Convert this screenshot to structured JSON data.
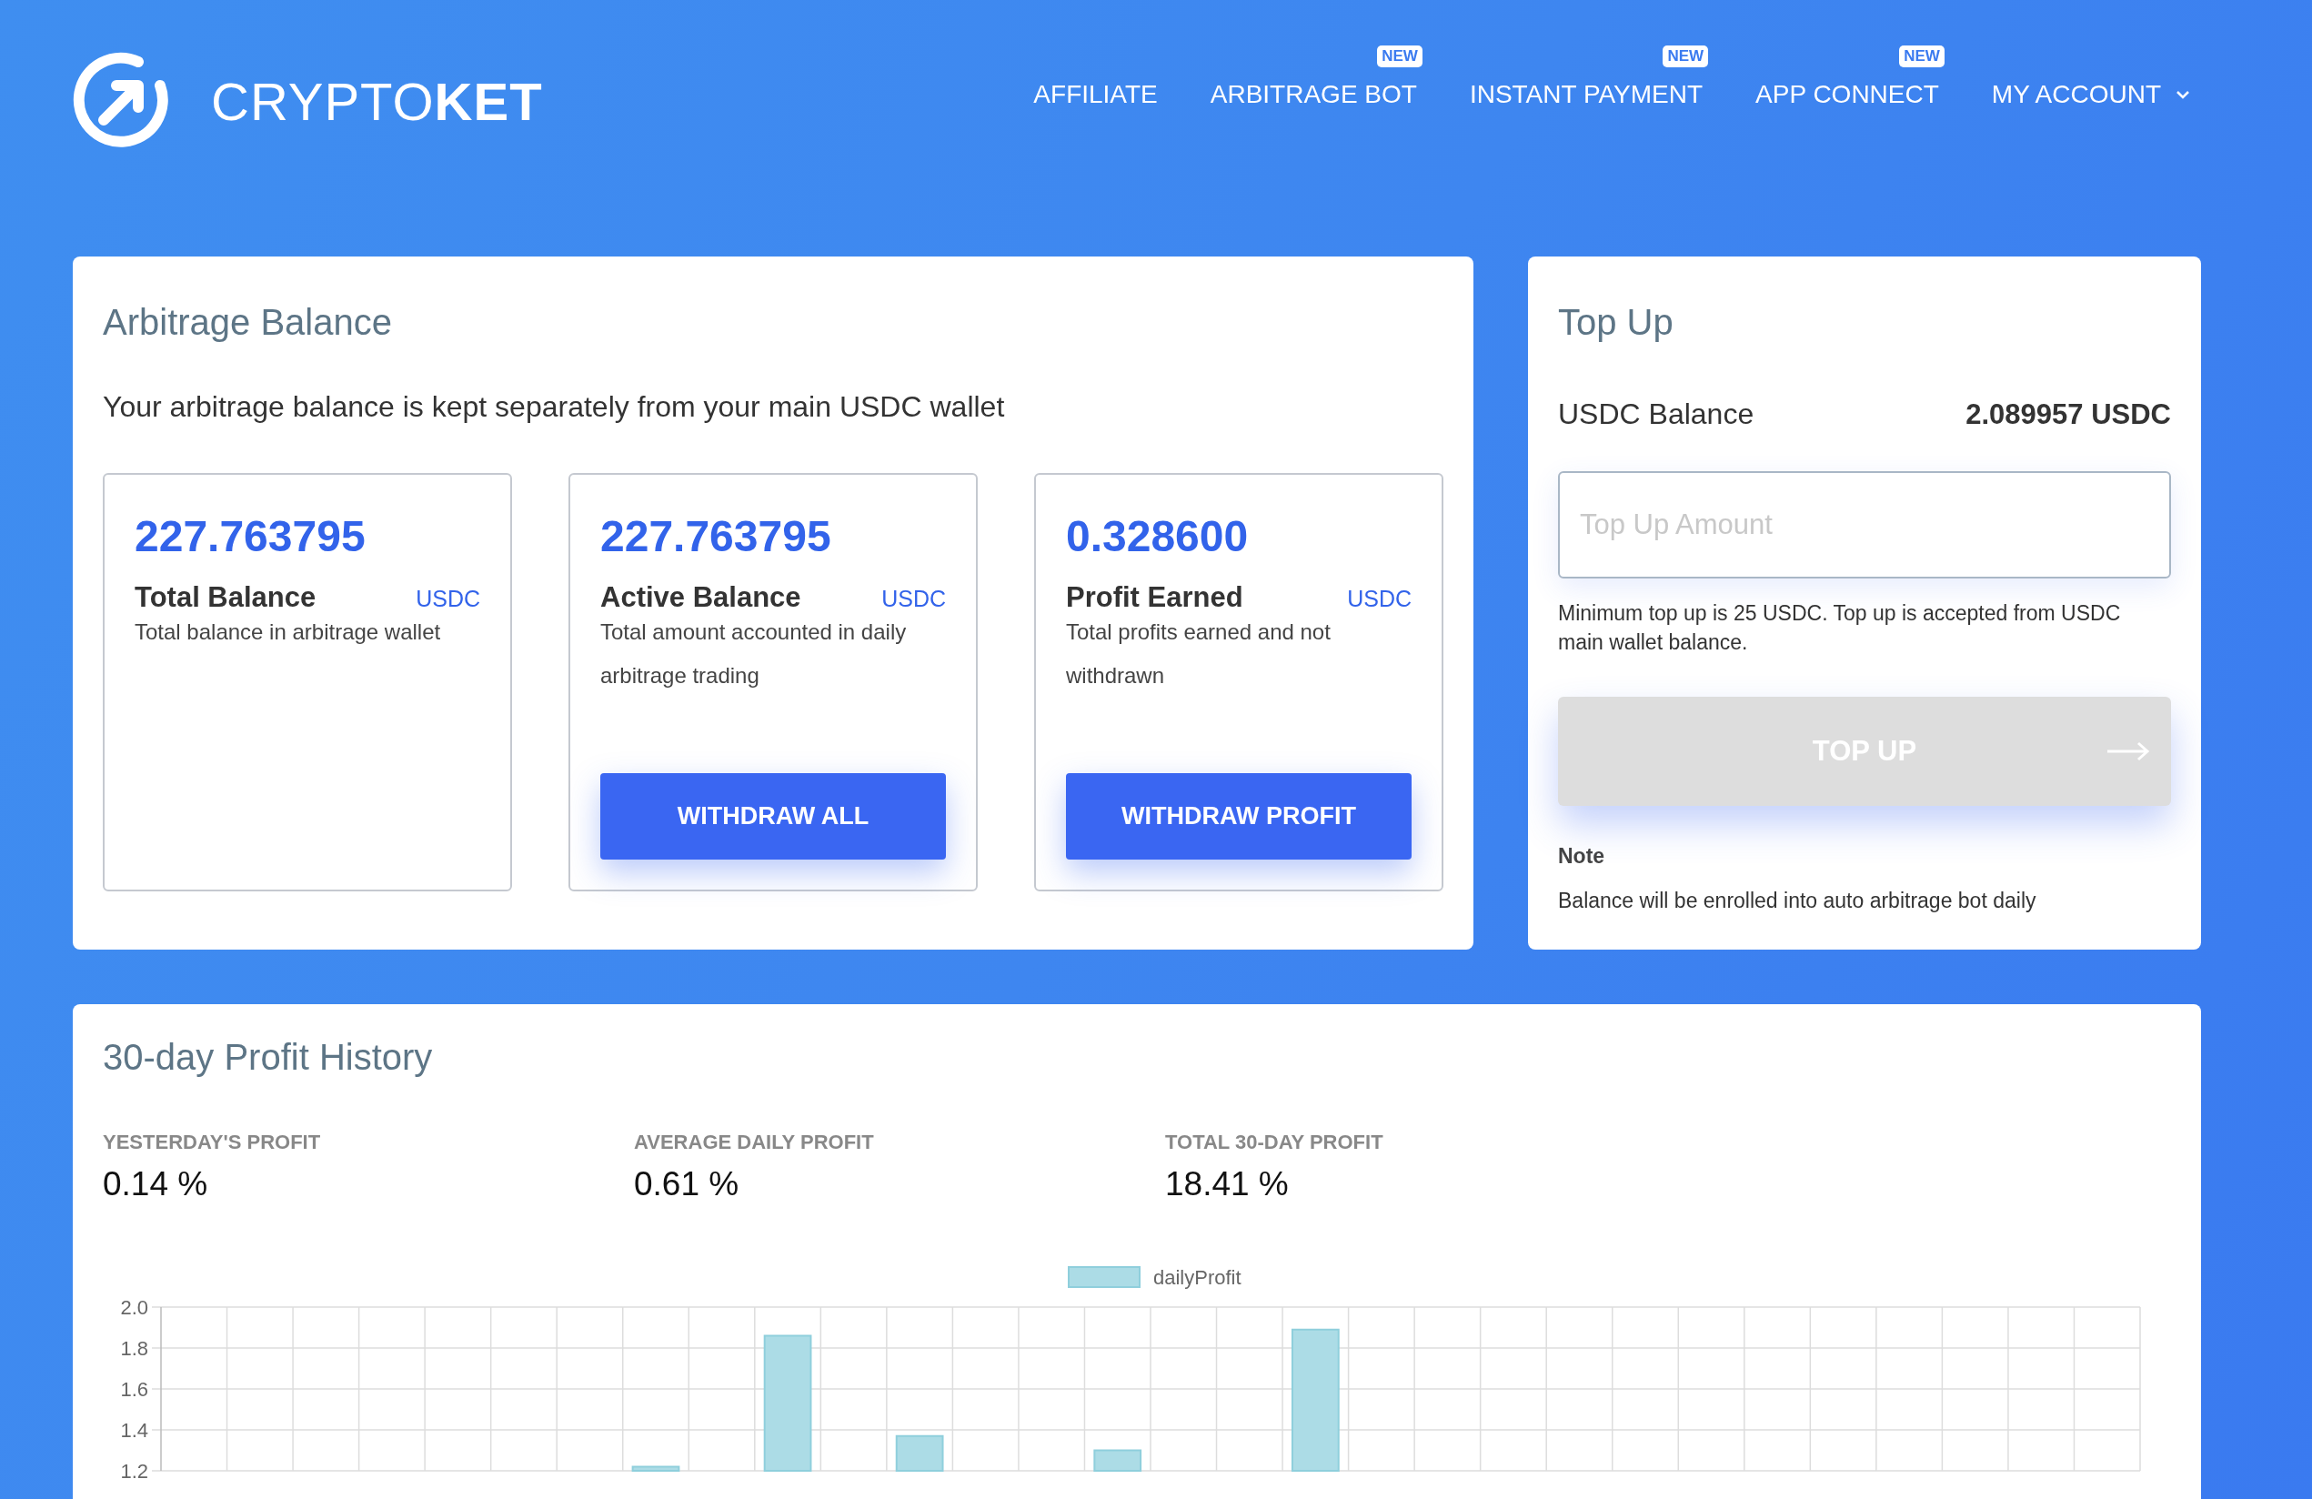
{
  "brand": "CRYPTO**KET**",
  "nav": [
    {
      "label": "AFFILIATE"
    },
    {
      "label": "ARBITRAGE BOT",
      "badge": "NEW"
    },
    {
      "label": "INSTANT PAYMENT",
      "badge": "NEW"
    },
    {
      "label": "APP CONNECT",
      "badge": "NEW"
    }
  ],
  "account": {
    "label": "MY ACCOUNT"
  },
  "arbitrage": {
    "title": "Arbitrage Balance",
    "subtitle": "Your arbitrage balance is kept separately from your main USDC wallet",
    "balances": [
      {
        "amount": "227.763795",
        "label": "Total Balance",
        "unit": "USDC",
        "description": "Total balance in arbitrage wallet"
      },
      {
        "amount": "227.763795",
        "label": "Active Balance",
        "unit": "USDC",
        "description": "Total amount accounted in daily arbitrage trading",
        "button": "WITHDRAW ALL"
      },
      {
        "amount": "0.328600",
        "label": "Profit Earned",
        "unit": "USDC",
        "description": "Total profits earned and not withdrawn",
        "button": "WITHDRAW PROFIT"
      }
    ]
  },
  "top_up": {
    "title": "Top Up",
    "balance_label": "USDC Balance",
    "balance_value": "2.089957 USDC",
    "placeholder": "Top Up Amount",
    "hint": "Minimum top up is 25 USDC. Top up is accepted from USDC main wallet balance.",
    "button": {
      "label": "TOP UP",
      "disabled": true
    },
    "note_title": "Note",
    "note_text": "Balance will be enrolled into auto arbitrage bot daily"
  },
  "history": {
    "title": "30-day Profit History",
    "stats": [
      {
        "label": "YESTERDAY'S PROFIT",
        "value": "0.14 %"
      },
      {
        "label": "AVERAGE DAILY PROFIT",
        "value": "0.61 %"
      },
      {
        "label": "TOTAL 30-DAY PROFIT",
        "value": "18.41 %"
      }
    ],
    "chart_data": {
      "type": "bar",
      "grid": true,
      "ylim": [
        1.2,
        2.0
      ],
      "yticks": [
        {
          "value": 2.0,
          "label": "2.0"
        },
        {
          "value": 1.8,
          "label": "1.8"
        },
        {
          "value": 1.6,
          "label": "1.6"
        },
        {
          "value": 1.4,
          "label": "1.4"
        },
        {
          "value": 1.2,
          "label": "1.2"
        }
      ],
      "series": [
        {
          "name": "dailyProfit",
          "color": "#acdce6",
          "values": [
            null,
            null,
            null,
            null,
            null,
            null,
            null,
            1.22,
            null,
            1.86,
            null,
            1.37,
            null,
            null,
            1.3,
            null,
            null,
            1.89,
            null,
            null,
            null,
            null,
            null,
            null,
            null,
            null,
            null,
            null,
            null,
            null
          ]
        }
      ]
    }
  }
}
